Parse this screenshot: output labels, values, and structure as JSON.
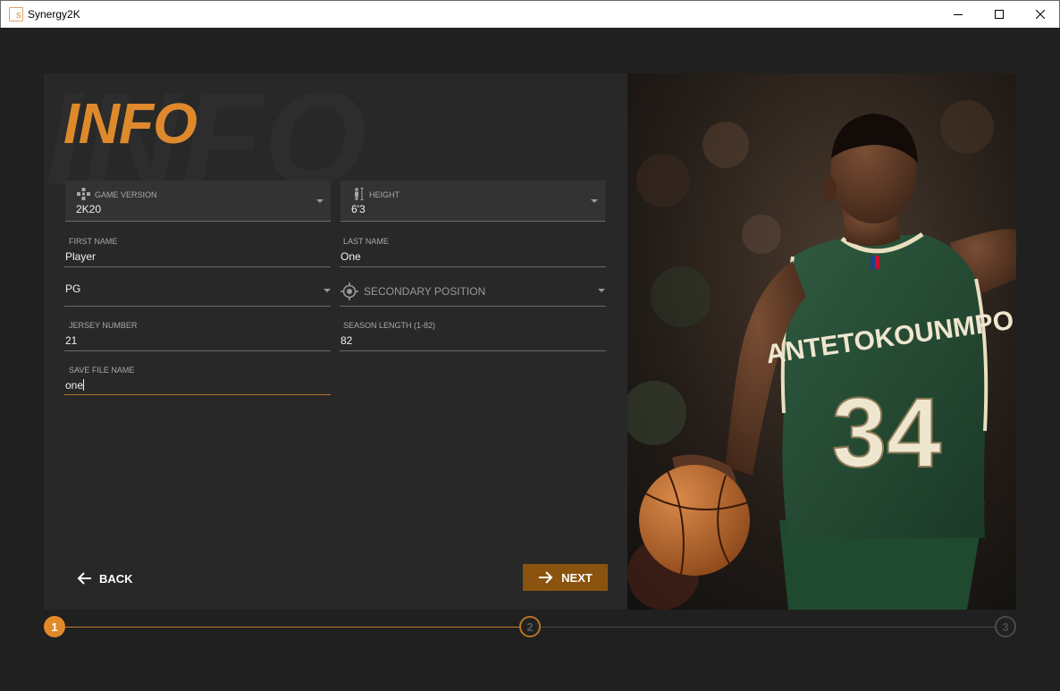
{
  "window": {
    "title": "Synergy2K",
    "icon_letter": "S"
  },
  "page": {
    "background_word": "INFO",
    "heading": "INFO",
    "accent_color": "#de8a2c"
  },
  "form": {
    "game_version": {
      "label": "GAME VERSION",
      "value": "2K20",
      "icon": "gamepad-icon"
    },
    "height": {
      "label": "HEIGHT",
      "value": "6'3",
      "icon": "person-height-icon"
    },
    "first_name": {
      "label": "FIRST NAME",
      "value": "Player"
    },
    "last_name": {
      "label": "LAST NAME",
      "value": "One"
    },
    "primary_position": {
      "value": "PG"
    },
    "secondary_position": {
      "placeholder": "SECONDARY POSITION",
      "icon": "crosshair-icon"
    },
    "jersey_number": {
      "label": "JERSEY NUMBER",
      "value": "21"
    },
    "season_length": {
      "label": "SEASON LENGTH (1-82)",
      "value": "82"
    },
    "save_file_name": {
      "label": "SAVE FILE NAME",
      "value": "one"
    }
  },
  "nav": {
    "back_label": "BACK",
    "next_label": "NEXT"
  },
  "stepper": {
    "steps": [
      "1",
      "2",
      "3"
    ],
    "current": 1
  },
  "photo": {
    "jersey_name": "ANTETOKOUNMPO",
    "jersey_number": "34"
  }
}
